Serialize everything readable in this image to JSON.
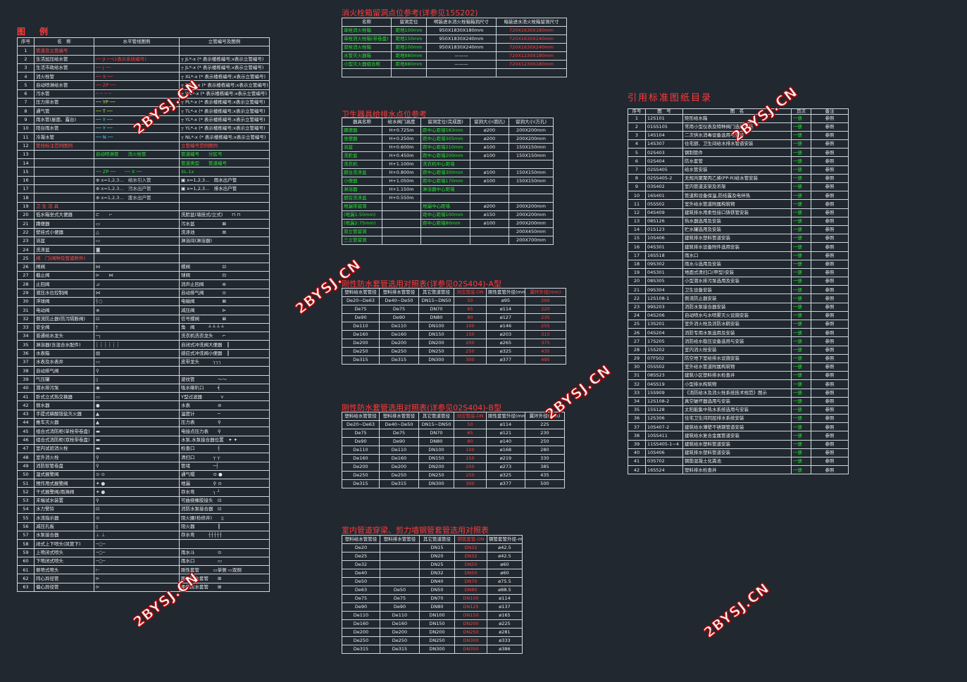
{
  "titles": {
    "legend": "图　例",
    "hydrant": "消火栓箱留洞点位参考(详参见15S202)",
    "fixture": "卫生器具给排水点位参考",
    "pipeA": "刚性防水套管选用对照表(详参见02S404)-A型",
    "pipeB": "刚性防水套管选用对照表(详参见02S404)-B型",
    "pipeC": "室内管道穿梁、剪力墙钢管套管选用对照表",
    "catalog": "引用标准图纸目录"
  },
  "legend": {
    "headers": [
      "序号",
      "名　称",
      "水平管线图例",
      "立管编号及图例"
    ],
    "rows": [
      {
        "n": "1",
        "name": "管道及立管编号",
        "sec": true,
        "h": "",
        "v": ""
      },
      {
        "n": "2",
        "name": "生活加压给水管",
        "h": "── JI ──(1表示系统编号)",
        "v": "┬ JL*-x (* 表示楼栋编号;x表示立管编号)"
      },
      {
        "n": "3",
        "name": "生活市政给水管",
        "h": "── J ──",
        "v": "┬ JL*-x (* 表示楼栋编号;x表示立管编号)"
      },
      {
        "n": "4",
        "name": "消火栓管",
        "h": "── X ──",
        "v": "┬ XL*-x (* 表示楼栋编号;x表示立管编号)"
      },
      {
        "n": "5",
        "name": "自动喷淋给水管",
        "h": "── ZP ──",
        "v": "┬ ZPL*-x (* 表示楼栋编号;x表示立管编号)"
      },
      {
        "n": "6",
        "name": "污水管",
        "h": "─ ─ ─ ─",
        "v": "┬ WL*-x (* 表示楼栋编号;x表示立管编号)"
      },
      {
        "n": "7",
        "name": "压力排水管",
        "h": "── YP ──",
        "v": "┬ PL*-x (* 表示楼栋编号;x表示立管编号)"
      },
      {
        "n": "8",
        "name": "通气管",
        "h": "── T ──",
        "v": "┬ TL*-x (* 表示楼栋编号;x表示立管编号)"
      },
      {
        "n": "9",
        "name": "雨水管(屋面、露台)",
        "h": "── Y ──",
        "v": "┬ YL*-x (* 表示楼栋编号;x表示立管编号)"
      },
      {
        "n": "10",
        "name": "阳台雨水管",
        "h": "── Y ──",
        "v": "┬ YL*-x (* 表示楼栋编号;x表示立管编号)"
      },
      {
        "n": "11",
        "name": "冷凝水管",
        "h": "── N ──",
        "v": "┬ NL*-x (* 表示楼栋编号;x表示立管编号)"
      },
      {
        "n": "12",
        "name": "管线标注范例图例",
        "sec": true,
        "h": "",
        "v": "立管编号范例图例"
      },
      {
        "n": "13",
        "name": "",
        "h": "自动喷淋管　　消火栓管",
        "v": "管道编号　　分区号"
      },
      {
        "n": "14",
        "name": "",
        "h": "",
        "v": "管道类型　　管道编号"
      },
      {
        "n": "15",
        "name": "",
        "h": "── ZP ──　　── X ──",
        "v": "XL-1x"
      },
      {
        "n": "16",
        "name": "",
        "h": "⊕ x=1,2,3...　给水引入管",
        "v": "▣ x=1,2,3...　雨水出户管"
      },
      {
        "n": "17",
        "name": "",
        "h": "⊕ x=1,2,3...　污水出户管",
        "v": "▣ x=1,2,3...　排水出户管"
      },
      {
        "n": "18",
        "name": "",
        "h": "⊕ x=1,2,3...　废水出户管",
        "v": ""
      },
      {
        "n": "19",
        "name": "卫 生 洁 具",
        "sec": true,
        "h": "",
        "v": ""
      },
      {
        "n": "20",
        "name": "低水箱坐式大便器",
        "h": "⊏　　⌐",
        "v": "洗脸盆(墙挂式/立式)　　⊓ ⊓"
      },
      {
        "n": "21",
        "name": "蹲便器",
        "h": "▭",
        "v": "污水盆　　　　　　⊠"
      },
      {
        "n": "22",
        "name": "壁挂式小便器",
        "h": "△",
        "v": "洗涤池　　　　　　⊞"
      },
      {
        "n": "23",
        "name": "浴盆",
        "h": "▭",
        "v": "淋浴间(淋浴器)"
      },
      {
        "n": "24",
        "name": "洗涤盆",
        "h": "◙",
        "v": ""
      },
      {
        "n": "25",
        "name": "阀　门(阀种及管道附件)",
        "sec": true,
        "h": "",
        "v": ""
      },
      {
        "n": "26",
        "name": "闸阀",
        "h": "⋈",
        "v": "蝶阀　　　　　　　⊡"
      },
      {
        "n": "27",
        "name": "截止阀",
        "h": "⊳　　⋈",
        "v": "球阀　　　　　　　⊡"
      },
      {
        "n": "28",
        "name": "止回阀",
        "h": "⊿",
        "v": "消声止回阀　　　　⊚"
      },
      {
        "n": "29",
        "name": "液压水位控制阀",
        "h": "⋈",
        "v": "自动排气阀　　　　⊙"
      },
      {
        "n": "30",
        "name": "浮球阀",
        "h": "┤○",
        "v": "电磁阀　　　　　　⊠"
      },
      {
        "n": "31",
        "name": "电动阀",
        "h": "⊗",
        "v": "减压阀　　　　　　⊳"
      },
      {
        "n": "32",
        "name": "倒流防止器(防污隔断阀)",
        "h": "⊡",
        "v": "信号蝶阀　　　　　⊠"
      },
      {
        "n": "33",
        "name": "安全阀",
        "h": "†",
        "v": "角　阀　　　┴ ┴ ┴ ┴"
      },
      {
        "n": "34",
        "name": "普通给水龙头",
        "h": "─┐",
        "v": "洗衣机洗衣龙头　　⌐"
      },
      {
        "n": "35",
        "name": "淋浴器(含混合水配件)",
        "h": "┆ ┆ ┆ ┆ ┆ ┆",
        "v": "自闭式冲洗阀大便器　┃"
      },
      {
        "n": "36",
        "name": "水表箱",
        "h": "▤",
        "v": "感应式冲洗阀小便器　┃"
      },
      {
        "n": "37",
        "name": "水表及水表井",
        "h": "▭",
        "v": "皮带龙头　　　┐┐┐"
      },
      {
        "n": "38",
        "name": "自动排气阀",
        "h": "⚲",
        "v": ""
      },
      {
        "n": "39",
        "name": "气压罐",
        "h": "▯",
        "v": "波纹管　　　　　～～"
      },
      {
        "n": "40",
        "name": "潜水排污泵",
        "h": "◉",
        "v": "吸水喇叭口　　　┥"
      },
      {
        "n": "41",
        "name": "卧式立式热交换器",
        "h": "▭",
        "v": "Y型过滤器　　　　⋎"
      },
      {
        "n": "42",
        "name": "倒水器",
        "h": "●",
        "v": "水表　　　　　　⊘"
      },
      {
        "n": "43",
        "name": "手提式磷酸铵盐灭火器",
        "h": "▲",
        "v": "温度计　　　　　─"
      },
      {
        "n": "44",
        "name": "推车灭火器",
        "h": "▲",
        "v": "压力表　　　　　⚲"
      },
      {
        "n": "45",
        "name": "组合式消防柜(单栓带卷盘)",
        "h": "▬",
        "v": "电接点压力表　　⚲"
      },
      {
        "n": "46",
        "name": "组合式消防柜(双栓带卷盘)",
        "h": "▬",
        "v": "水泵,水泵接合器位置　✦ ✦"
      },
      {
        "n": "47",
        "name": "室内试验消火栓",
        "h": "▬",
        "v": "检查口　　　　　┤"
      },
      {
        "n": "48",
        "name": "室外消火栓",
        "h": "⚲",
        "v": "清扫口　　　　┬ ┬"
      },
      {
        "n": "49",
        "name": "消防软管卷盘",
        "h": "⚲",
        "v": "管堵　　　　　─┤"
      },
      {
        "n": "50",
        "name": "湿式报警阀",
        "h": "⊙ ⊙",
        "v": "通气帽　　　　⊙ ●"
      },
      {
        "n": "51",
        "name": "预作用式报警阀",
        "h": "✦ ●",
        "v": "地漏　　　　　⚲ ⊙"
      },
      {
        "n": "52",
        "name": "干式报警阀/雨淋阀",
        "h": "✦ ●",
        "v": "存水弯　　　　┐ ┘"
      },
      {
        "n": "53",
        "name": "末端试水装置",
        "h": "⚲",
        "v": "可曲挠橡胶接头　⊡"
      },
      {
        "n": "54",
        "name": "水力警铃",
        "h": "⊡",
        "v": "消防水泵接合器　⊡"
      },
      {
        "n": "55",
        "name": "水流指示器",
        "h": "⊙",
        "v": "阻火圈(检修井)　　▯"
      },
      {
        "n": "56",
        "name": "减压孔板",
        "h": "▯",
        "v": "阻火器　　　　　┃"
      },
      {
        "n": "57",
        "name": "水泵接合器",
        "h": "⊥ ⊥",
        "v": "存水弯　　　┤┤┤┤┤"
      },
      {
        "n": "58",
        "name": "闭式上下喷头(风管下)",
        "h": "─○─",
        "v": ""
      },
      {
        "n": "59",
        "name": "上喷闭式喷头",
        "h": "─○─",
        "v": "雨水斗　　　　　⊙"
      },
      {
        "n": "60",
        "name": "下喷闭式喷头",
        "h": "─○─",
        "v": "雨水口　　　　　▭"
      },
      {
        "n": "61",
        "name": "侧喷式喷头",
        "h": "⊢",
        "v": "刚性套管　　　▭单侧 ▭双侧"
      },
      {
        "n": "62",
        "name": "同心异径管",
        "h": "⊳",
        "v": "刚性防水套管　　⊞"
      },
      {
        "n": "63",
        "name": "偏心异径管",
        "h": "⊳",
        "v": "柔性防水套管　　⊞"
      }
    ]
  },
  "hydrant": {
    "headers": [
      "名称",
      "留洞定位",
      "明装进水消火栓箱箱洞尺寸",
      "暗装进水消火栓箱留洞尺寸"
    ],
    "rows": [
      [
        "单栓消火栓箱",
        "距地100mm",
        "950X1830X180mm",
        "720X1630X180mm"
      ],
      [
        "单栓消火栓箱(带卷盘)",
        "距地150mm",
        "950X1830X240mm",
        "720X1630X240mm"
      ],
      [
        "双栓消火栓箱",
        "距地100mm",
        "950X1830X240mm",
        "720X1630X240mm"
      ],
      [
        "水管灭火器箱",
        "距地880mm",
        "———",
        "720X1230X180mm"
      ],
      [
        "小型灭火器组合柜",
        "距地880mm",
        "———",
        "720X1230X180mm"
      ],
      [
        "",
        "",
        "",
        ""
      ]
    ]
  },
  "fixture": {
    "headers": [
      "器具名称",
      "给水阀门高度",
      "留洞定位(完成面)",
      "留洞大小(圆孔)",
      "留洞大小(方孔)"
    ],
    "rows": [
      [
        "蹲便器",
        "H+0.725m",
        "距中心距墙583mm",
        "ø200",
        "200X200mm"
      ],
      [
        "坐便器",
        "H+0.250m",
        "距中心距墙305mm",
        "ø200",
        "200X200mm"
      ],
      [
        "浴盆",
        "H+0.600m",
        "距中心距墙210mm",
        "ø100",
        "150X150mm"
      ],
      [
        "洗脸盆",
        "H+0.450m",
        "距中心距墙200mm",
        "ø100",
        "150X150mm"
      ],
      [
        "洗衣机",
        "H+1.100m",
        "洗衣机中心距墙",
        "",
        ""
      ],
      [
        "厨台洗涤盆",
        "H+0.800m",
        "距中心距墙300mm",
        "ø100",
        "150X150mm"
      ],
      [
        "小便器",
        "H+1.050m",
        "距中心距墙170mm",
        "ø100",
        "150X150mm"
      ],
      [
        "淋浴器",
        "H+1.150m",
        "淋浴器中心距墙",
        "",
        ""
      ],
      [
        "厨房洗涤盆",
        "H+0.550m",
        "",
        "",
        ""
      ],
      [
        "地漏带留洞",
        "",
        "地漏中心距墙",
        "ø200",
        "200X200mm"
      ],
      [
        "(地漏1:50mm)",
        "",
        "距中心距墙100mm",
        "ø150",
        "200X200mm"
      ],
      [
        "(地漏2:75mm)",
        "",
        "距中心距墙80mm",
        "ø100",
        "200X200mm"
      ],
      [
        "双立管留洞",
        "",
        "",
        "",
        "200X450mm"
      ],
      [
        "三立管留洞",
        "",
        "",
        "",
        "200X700mm"
      ]
    ]
  },
  "pipeA": {
    "headers": [
      "塑料给水管管径",
      "塑料排水管管径",
      "其它管道管径",
      "对应管底-DN",
      "刚性套管外径(mm)",
      "翼环外径(mm)"
    ],
    "rows": [
      [
        "De20~De63",
        "De40~De50",
        "DN15~DN50",
        "50",
        "ø95",
        "200"
      ],
      [
        "De75",
        "De75",
        "DN70",
        "65",
        "ø114",
        "220"
      ],
      [
        "De90",
        "De90",
        "DN80",
        "80",
        "ø127",
        "235"
      ],
      [
        "De110",
        "De110",
        "DN100",
        "100",
        "ø146",
        "255"
      ],
      [
        "De160",
        "De160",
        "DN150",
        "150",
        "ø203",
        "315"
      ],
      [
        "De200",
        "De200",
        "DN200",
        "200",
        "ø265",
        "375"
      ],
      [
        "De250",
        "De250",
        "DN250",
        "250",
        "ø325",
        "435"
      ],
      [
        "De315",
        "De315",
        "DN300",
        "300",
        "ø377",
        "495"
      ]
    ]
  },
  "pipeB": {
    "headers": [
      "塑料给水管管径",
      "塑料排水管管径",
      "其它管道管径",
      "对应管底-DN",
      "刚性套管外径(mm)",
      "翼环外径(mm)"
    ],
    "rows": [
      [
        "De20~De63",
        "De40~De50",
        "DN15~DN50",
        "50",
        "ø114",
        "225"
      ],
      [
        "De75",
        "De75",
        "DN70",
        "65",
        "ø121",
        "230"
      ],
      [
        "De90",
        "De90",
        "DN80",
        "80",
        "ø140",
        "250"
      ],
      [
        "De110",
        "De110",
        "DN100",
        "100",
        "ø168",
        "280"
      ],
      [
        "De160",
        "De160",
        "DN150",
        "150",
        "ø219",
        "330"
      ],
      [
        "De200",
        "De200",
        "DN200",
        "200",
        "ø273",
        "385"
      ],
      [
        "De250",
        "De250",
        "DN250",
        "250",
        "ø325",
        "435"
      ],
      [
        "De315",
        "De315",
        "DN300",
        "300",
        "ø377",
        "500"
      ]
    ]
  },
  "pipeC": {
    "headers": [
      "塑料给水管管径",
      "塑料排水管管径",
      "其它管道管径",
      "钢管套管-DN",
      "钢管套管外径-mm"
    ],
    "rows": [
      [
        "De20",
        "",
        "DN15",
        "DN32",
        "ø42.5"
      ],
      [
        "De25",
        "",
        "DN20",
        "DN32",
        "ø42.5"
      ],
      [
        "De32",
        "",
        "DN25",
        "DN50",
        "ø60"
      ],
      [
        "De40",
        "",
        "DN32",
        "DN50",
        "ø60"
      ],
      [
        "De50",
        "",
        "DN40",
        "DN70",
        "ø75.5"
      ],
      [
        "De63",
        "De50",
        "DN50",
        "DN80",
        "ø88.5"
      ],
      [
        "De75",
        "De75",
        "DN70",
        "DN100",
        "ø114"
      ],
      [
        "De90",
        "De90",
        "DN80",
        "DN125",
        "ø137"
      ],
      [
        "De110",
        "De110",
        "DN100",
        "DN150",
        "ø165"
      ],
      [
        "De160",
        "De160",
        "DN150",
        "DN200",
        "ø225"
      ],
      [
        "De200",
        "De200",
        "DN200",
        "DN250",
        "ø281"
      ],
      [
        "De250",
        "De250",
        "DN250",
        "DN300",
        "ø333"
      ],
      [
        "De315",
        "De315",
        "DN300",
        "DN350",
        "ø386"
      ]
    ]
  },
  "catalog": {
    "headers": [
      "序号",
      "图　号",
      "图　名",
      "页次",
      "备注"
    ],
    "rows": [
      [
        "1",
        "12S101",
        "矩形给水箱",
        "一册",
        "参照"
      ],
      [
        "2",
        "01SS105",
        "常用小型仪表及特种阀门选用安装",
        "一册",
        "参照"
      ],
      [
        "3",
        "14S104",
        "二次供水消毒设备选用与安装",
        "一册",
        "参照"
      ],
      [
        "4",
        "14S307",
        "住宅厨、卫生间给水排水管道安装",
        "一册",
        "参照"
      ],
      [
        "5",
        "02S403",
        "钢制管件",
        "一册",
        "参照"
      ],
      [
        "6",
        "02S404",
        "防水套管",
        "一册",
        "参照"
      ],
      [
        "7",
        "02SS405",
        "给水管安装",
        "一册",
        "参照"
      ],
      [
        "8",
        "02SS405-2",
        "无规共聚聚丙乙烯(PP-R)给水管安装",
        "一册",
        "参照"
      ],
      [
        "9",
        "03S402",
        "室内管道支架及吊架",
        "一册",
        "参照"
      ],
      [
        "10",
        "16S401",
        "管道和设备保温,防结露及电伴热",
        "一册",
        "参照"
      ],
      [
        "11",
        "05SS02",
        "室外给水管道附属构筑物",
        "一册",
        "参照"
      ],
      [
        "12",
        "04S409",
        "建筑排水用柔性接口铸铁管安装",
        "一册",
        "参照"
      ],
      [
        "13",
        "08S126",
        "热水器选用及安装",
        "一册",
        "参照"
      ],
      [
        "14",
        "01S123",
        "贮水罐选用及安装",
        "一册",
        "参照"
      ],
      [
        "15",
        "10S406",
        "建筑排水塑料管道安装",
        "一册",
        "参照"
      ],
      [
        "16",
        "04S301",
        "建筑排水设备附件选用安装",
        "一册",
        "参照"
      ],
      [
        "17",
        "16S518",
        "雨水口",
        "一册",
        "参照"
      ],
      [
        "18",
        "09S302",
        "雨水斗选用及安装",
        "一册",
        "参照"
      ],
      [
        "19",
        "04S301",
        "地面式清扫口(甲型)安装",
        "一册",
        "参照"
      ],
      [
        "20",
        "08S305",
        "小型潜水排污泵选用及安装",
        "一册",
        "参照"
      ],
      [
        "21",
        "09S304",
        "卫生设备安装",
        "一册",
        "参照"
      ],
      [
        "22",
        "12S108-1",
        "倒流防止器安装",
        "一册",
        "参照"
      ],
      [
        "23",
        "99S203",
        "消防水泵接合器安装",
        "一册",
        "参照"
      ],
      [
        "24",
        "04S206",
        "自动喷水与水喷雾灭火设施安装",
        "一册",
        "参照"
      ],
      [
        "25",
        "13S201",
        "室外消火栓及消防水鹤安装",
        "一册",
        "参照"
      ],
      [
        "26",
        "04S204",
        "消防专用水泵选用及安装",
        "一册",
        "参照"
      ],
      [
        "27",
        "17S205",
        "消防给水稳压设备选用与安装",
        "一册",
        "参照"
      ],
      [
        "28",
        "15S202",
        "室内消火栓安装",
        "一册",
        "参照"
      ],
      [
        "29",
        "07FS02",
        "防空地下室给排水设施安装",
        "一册",
        "参照"
      ],
      [
        "30",
        "05SS02",
        "室外给水管道附属构筑物",
        "一册",
        "参照"
      ],
      [
        "31",
        "08SS23",
        "建筑小区塑料排水检查井",
        "一册",
        "参照"
      ],
      [
        "32",
        "04SS19",
        "小型排水构筑物",
        "一册",
        "参照"
      ],
      [
        "33",
        "15S909",
        "《消防给水及消火栓系统技术规范》图示",
        "一册",
        "参照"
      ],
      [
        "34",
        "12S108-2",
        "真空破坏器选用与安装",
        "一册",
        "参照"
      ],
      [
        "35",
        "15S128",
        "太阳能集中热水系统选用与安装",
        "一册",
        "参照"
      ],
      [
        "36",
        "12S306",
        "住宅卫生间同层排水系统安装",
        "一册",
        "参照"
      ],
      [
        "37",
        "10S407-2",
        "建筑给水薄壁不锈钢管道安装",
        "一册",
        "参照"
      ],
      [
        "38",
        "10SS411",
        "建筑给水复合金属管道安装",
        "一册",
        "参照"
      ],
      [
        "39",
        "11SS405-1~4",
        "建筑给水塑料管道安装",
        "一册",
        "参照"
      ],
      [
        "40",
        "10S406",
        "建筑排水塑料管道安装",
        "一册",
        "参照"
      ],
      [
        "41",
        "03S702",
        "钢筋混凝土化粪池",
        "一册",
        "参照"
      ],
      [
        "42",
        "16S524",
        "塑料排水检查井",
        "一册",
        "参照"
      ]
    ]
  },
  "watermark": "2BYSJ.CN",
  "colors": {
    "background": "#212830",
    "legendBorder": "#d7f03c",
    "hydrantBorder": "#d7f03c",
    "fixtureBorder": "#d7f03c",
    "pipeBorder": "#cfd8e0",
    "catalogBorder": "#ff6ec7",
    "red": "#ff3b3b",
    "green": "#25e02f"
  }
}
